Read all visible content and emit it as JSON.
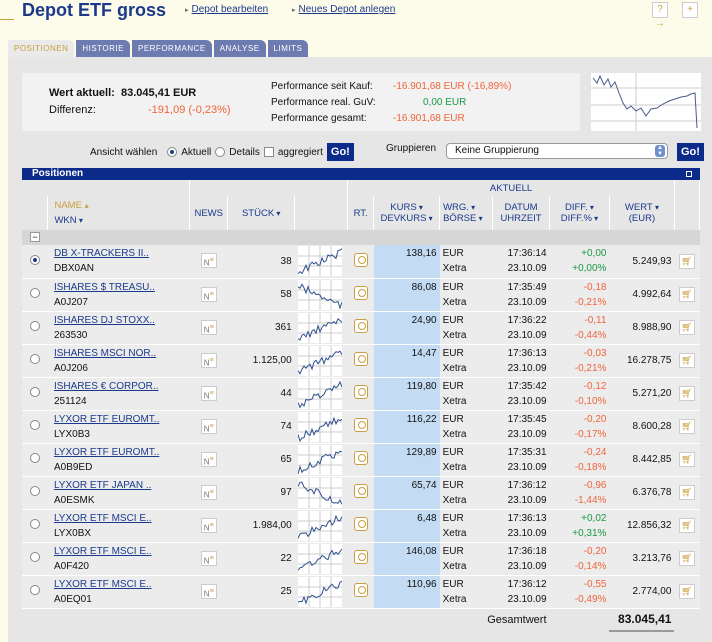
{
  "header": {
    "title": "Depot ETF gross",
    "links": [
      "Depot bearbeiten",
      "Neues Depot anlegen"
    ],
    "icons": [
      "help-icon",
      "new-page-icon"
    ]
  },
  "tabs": [
    "POSITIONEN",
    "HISTORIE",
    "PERFORMANCE",
    "ANALYSE",
    "LIMITS"
  ],
  "active_tab": "POSITIONEN",
  "summary": {
    "wert_label": "Wert aktuell:",
    "wert": "83.045,41 EUR",
    "diff_label": "Differenz:",
    "diff": "-191,09 (-0,23%)",
    "perf_kauf_label": "Performance seit Kauf:",
    "perf_kauf": "-16.901,68 EUR (-16,89%)",
    "perf_real_label": "Performance real. GuV:",
    "perf_real": "0,00 EUR",
    "perf_ges_label": "Performance gesamt:",
    "perf_ges": "-16.901,68 EUR"
  },
  "controls": {
    "ansicht_label": "Ansicht wählen",
    "opt_aktuell": "Aktuell",
    "opt_details": "Details",
    "aggregiert": "aggregiert",
    "go": "Go!",
    "gruppieren_label": "Gruppieren",
    "gruppierung": "Keine Gruppierung",
    "selected_view": "Aktuell",
    "aggregiert_checked": false
  },
  "table": {
    "section": "Positionen",
    "group_header": "AKTUELL",
    "headers": {
      "name": "NAME",
      "wkn": "WKN",
      "news": "NEWS",
      "stueck": "STÜCK",
      "rt": "RT.",
      "kurs": "KURS",
      "devkurs": "DEVKURS",
      "wrg": "WRG.",
      "boerse": "BÖRSE",
      "datum": "DATUM",
      "uhrzeit": "UHRZEIT",
      "diff": "DIFF.",
      "diffp": "DIFF.%",
      "wert": "WERT",
      "eur": "(EUR)"
    },
    "collapse": "−",
    "rows": [
      {
        "name": "DB X-TRACKERS II..",
        "wkn": "DBX0AN",
        "stueck": "38",
        "kurs": "138,16",
        "wrg": "EUR",
        "boerse": "Xetra",
        "zeit": "17:36:14",
        "datum": "23.10.09",
        "diff": "+0,00",
        "diffp": "+0,00%",
        "wert": "5.249,93",
        "selected": true
      },
      {
        "name": "ISHARES $ TREASU..",
        "wkn": "A0J207",
        "stueck": "58",
        "kurs": "86,08",
        "wrg": "EUR",
        "boerse": "Xetra",
        "zeit": "17:35:49",
        "datum": "23.10.09",
        "diff": "-0,18",
        "diffp": "-0,21%",
        "wert": "4.992,64"
      },
      {
        "name": "ISHARES DJ STOXX..",
        "wkn": "263530",
        "stueck": "361",
        "kurs": "24,90",
        "wrg": "EUR",
        "boerse": "Xetra",
        "zeit": "17:36:22",
        "datum": "23.10.09",
        "diff": "-0,11",
        "diffp": "-0,44%",
        "wert": "8.988,90"
      },
      {
        "name": "ISHARES MSCI NOR..",
        "wkn": "A0J206",
        "stueck": "1.125,00",
        "kurs": "14,47",
        "wrg": "EUR",
        "boerse": "Xetra",
        "zeit": "17:36:13",
        "datum": "23.10.09",
        "diff": "-0,03",
        "diffp": "-0,21%",
        "wert": "16.278,75"
      },
      {
        "name": "ISHARES € CORPOR..",
        "wkn": "251124",
        "stueck": "44",
        "kurs": "119,80",
        "wrg": "EUR",
        "boerse": "Xetra",
        "zeit": "17:35:42",
        "datum": "23.10.09",
        "diff": "-0,12",
        "diffp": "-0,10%",
        "wert": "5.271,20"
      },
      {
        "name": "LYXOR ETF EUROMT..",
        "wkn": "LYX0B3",
        "stueck": "74",
        "kurs": "116,22",
        "wrg": "EUR",
        "boerse": "Xetra",
        "zeit": "17:35:45",
        "datum": "23.10.09",
        "diff": "-0,20",
        "diffp": "-0,17%",
        "wert": "8.600,28"
      },
      {
        "name": "LYXOR ETF EUROMT..",
        "wkn": "A0B9ED",
        "stueck": "65",
        "kurs": "129,89",
        "wrg": "EUR",
        "boerse": "Xetra",
        "zeit": "17:35:31",
        "datum": "23.10.09",
        "diff": "-0,24",
        "diffp": "-0,18%",
        "wert": "8.442,85"
      },
      {
        "name": "LYXOR ETF JAPAN ..",
        "wkn": "A0ESMK",
        "stueck": "97",
        "kurs": "65,74",
        "wrg": "EUR",
        "boerse": "Xetra",
        "zeit": "17:36:12",
        "datum": "23.10.09",
        "diff": "-0,96",
        "diffp": "-1,44%",
        "wert": "6.376,78"
      },
      {
        "name": "LYXOR ETF MSCI E..",
        "wkn": "LYX0BX",
        "stueck": "1.984,00",
        "kurs": "6,48",
        "wrg": "EUR",
        "boerse": "Xetra",
        "zeit": "17:36:13",
        "datum": "23.10.09",
        "diff": "+0,02",
        "diffp": "+0,31%",
        "wert": "12.856,32"
      },
      {
        "name": "LYXOR ETF MSCI E..",
        "wkn": "A0F420",
        "stueck": "22",
        "kurs": "146,08",
        "wrg": "EUR",
        "boerse": "Xetra",
        "zeit": "17:36:18",
        "datum": "23.10.09",
        "diff": "-0,20",
        "diffp": "-0,14%",
        "wert": "3.213,76"
      },
      {
        "name": "LYXOR ETF MSCI E..",
        "wkn": "A0EQ01",
        "stueck": "25",
        "kurs": "110,96",
        "wrg": "EUR",
        "boerse": "Xetra",
        "zeit": "17:36:12",
        "datum": "23.10.09",
        "diff": "-0,55",
        "diffp": "-0,49%",
        "wert": "2.774,00"
      }
    ],
    "total_label": "Gesamtwert",
    "total": "83.045,41"
  },
  "colors": {
    "brand": "#1b3a8c",
    "bar": "#0b2a8a",
    "negative": "#f0643a",
    "positive": "#1a9a48",
    "kurs_bg": "#c4dcf3"
  }
}
